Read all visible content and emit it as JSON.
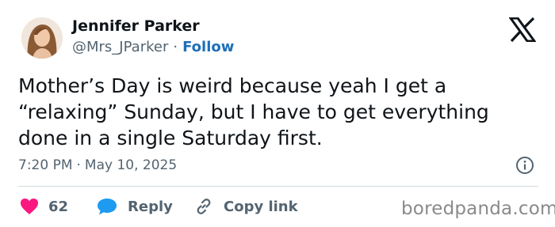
{
  "author": {
    "name": "Jennifer Parker",
    "handle": "@Mrs_JParker",
    "separator": "·",
    "follow_label": "Follow"
  },
  "tweet": {
    "text": "Mother’s Day is weird because yeah I get a “relaxing” Sunday, but I have to get everything done in a single Saturday first.",
    "time": "7:20 PM",
    "separator": "·",
    "date": "May 10, 2025"
  },
  "actions": {
    "like_count": "62",
    "reply_label": "Reply",
    "copy_link_label": "Copy link"
  },
  "watermark": "boredpanda.com",
  "icons": {
    "brand": "x-logo-icon",
    "info": "info-icon",
    "like": "heart-icon",
    "reply": "speech-bubble-icon",
    "copy": "link-icon"
  },
  "colors": {
    "like": "#f91880",
    "reply": "#1d9bf0",
    "follow": "#1d6fb8",
    "secondary_text": "#536471"
  }
}
